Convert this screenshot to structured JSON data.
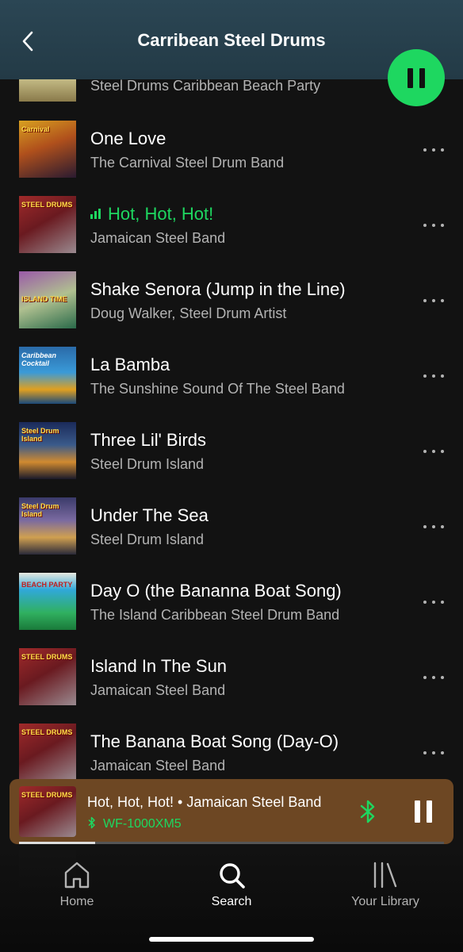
{
  "header": {
    "title": "Carribean Steel Drums"
  },
  "tracks": [
    {
      "title": "",
      "artist": "Steel Drums Caribbean Beach Party",
      "art_label": ""
    },
    {
      "title": "One Love",
      "artist": "The Carnival Steel Drum Band",
      "art_label": "Carnival"
    },
    {
      "title": "Hot, Hot, Hot!",
      "artist": "Jamaican Steel Band",
      "art_label": "STEEL DRUMS"
    },
    {
      "title": "Shake Senora (Jump in the Line)",
      "artist": "Doug Walker, Steel Drum Artist",
      "art_label": "ISLAND TIME"
    },
    {
      "title": "La Bamba",
      "artist": "The Sunshine Sound Of The Steel Band",
      "art_label": "Caribbean Cocktail"
    },
    {
      "title": "Three Lil' Birds",
      "artist": "Steel Drum Island",
      "art_label": "Steel Drum Island"
    },
    {
      "title": "Under The Sea",
      "artist": "Steel Drum Island",
      "art_label": "Steel Drum Island"
    },
    {
      "title": "Day O (the Bananna Boat Song)",
      "artist": "The Island Caribbean Steel Drum Band",
      "art_label": "BEACH PARTY"
    },
    {
      "title": "Island In The Sun",
      "artist": "Jamaican Steel Band",
      "art_label": "STEEL DRUMS"
    },
    {
      "title": "The Banana Boat Song (Day-O)",
      "artist": "Jamaican Steel Band",
      "art_label": "STEEL DRUMS"
    }
  ],
  "now_playing": {
    "title_line": "Hot, Hot, Hot! • Jamaican Steel Band",
    "device": "WF-1000XM5",
    "art_label": "STEEL DRUMS",
    "progress": 0.18
  },
  "nav": {
    "home": "Home",
    "search": "Search",
    "library": "Your Library"
  },
  "colors": {
    "accent": "#1ed760",
    "header_bg": "#2b4654",
    "mini_player_bg": "#6d4723"
  },
  "icons": {
    "back": "chevron-left-icon",
    "pause": "pause-icon",
    "more": "more-horizontal-icon",
    "bluetooth": "bluetooth-icon",
    "home": "home-icon",
    "search": "search-icon",
    "library": "library-icon"
  }
}
